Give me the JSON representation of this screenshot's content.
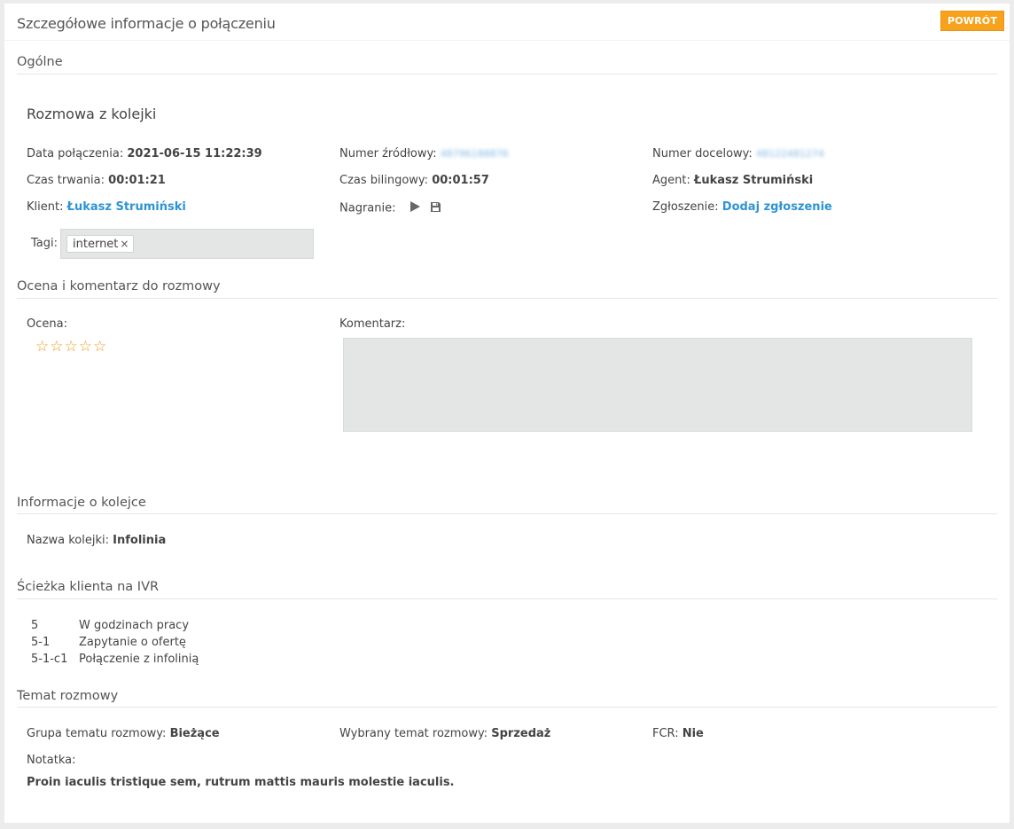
{
  "header": {
    "title": "Szczegółowe informacje o połączeniu",
    "back_label": "POWRÓT"
  },
  "general": {
    "section_title": "Ogólne",
    "call_type": "Rozmowa z kolejki",
    "call_date_label": "Data połączenia:",
    "call_date": "2021-06-15 11:22:39",
    "source_label": "Numer źródłowy:",
    "source_number": "48796188876",
    "dest_label": "Numer docelowy:",
    "dest_number": "48122481274",
    "duration_label": "Czas trwania:",
    "duration": "00:01:21",
    "billing_label": "Czas bilingowy:",
    "billing": "00:01:57",
    "agent_label": "Agent:",
    "agent": "Łukasz Strumiński",
    "client_label": "Klient:",
    "client": "Łukasz Strumiński",
    "recording_label": "Nagranie:",
    "ticket_label": "Zgłoszenie:",
    "ticket_link": "Dodaj zgłoszenie",
    "tags_label": "Tagi:",
    "tags": [
      "internet"
    ],
    "tag_remove": "×"
  },
  "rating": {
    "section_title": "Ocena i komentarz do rozmowy",
    "rating_label": "Ocena:",
    "stars_max": 5,
    "stars_value": 0,
    "star_glyph": "☆",
    "comment_label": "Komentarz:",
    "comment_value": ""
  },
  "queue": {
    "section_title": "Informacje o kolejce",
    "name_label": "Nazwa kolejki:",
    "name": "Infolinia"
  },
  "ivr": {
    "section_title": "Ścieżka klienta na IVR",
    "rows": [
      {
        "code": "5",
        "text": "W godzinach pracy"
      },
      {
        "code": "5-1",
        "text": "Zapytanie o ofertę"
      },
      {
        "code": "5-1-c1",
        "text": "Połączenie z infolinią"
      }
    ]
  },
  "topic": {
    "section_title": "Temat rozmowy",
    "group_label": "Grupa tematu rozmowy:",
    "group": "Bieżące",
    "selected_label": "Wybrany temat rozmowy:",
    "selected": "Sprzedaż",
    "fcr_label": "FCR:",
    "fcr": "Nie",
    "note_label": "Notatka:",
    "note": "Proin iaculis tristique sem, rutrum mattis mauris molestie iaculis."
  },
  "colors": {
    "accent_orange": "#f7a21c",
    "link_blue": "#2f93d3",
    "star_orange": "#f29a1a"
  }
}
